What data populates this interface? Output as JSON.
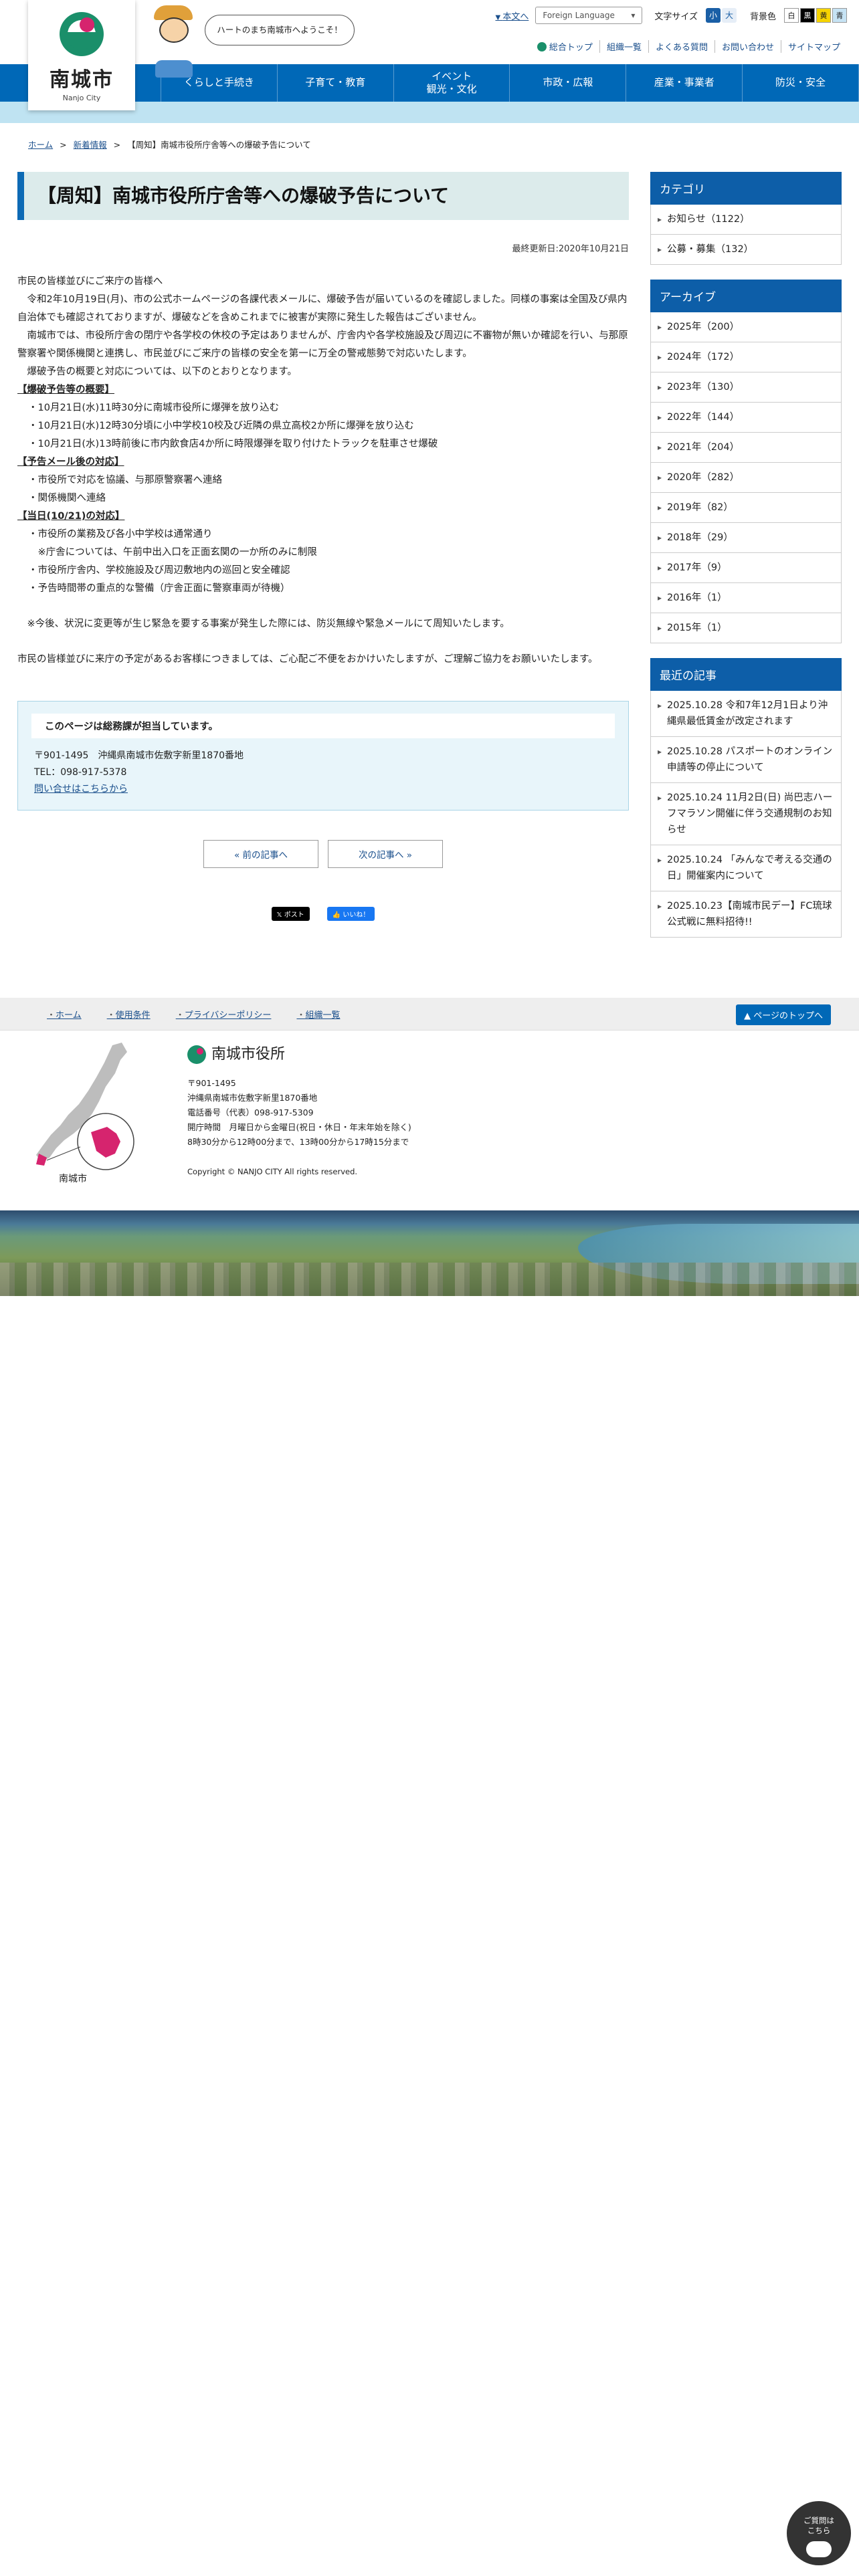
{
  "header": {
    "logo_name": "南城市",
    "logo_sub": "Nanjo City",
    "bubble": "ハートのまち南城市へようこそ！",
    "skip_link": "本文へ",
    "foreign_language": "Foreign Language",
    "font_size_label": "文字サイズ",
    "font_size_small": "小",
    "font_size_large": "大",
    "bg_color_label": "背景色",
    "bg_white": "白",
    "bg_black": "黒",
    "bg_yellow": "黄",
    "bg_blue": "青",
    "util_links": [
      "総合トップ",
      "組織一覧",
      "よくある質問",
      "お問い合わせ",
      "サイトマップ"
    ]
  },
  "nav": {
    "items": [
      "くらしと手続き",
      "子育て・教育",
      "イベント\n観光・文化",
      "市政・広報",
      "産業・事業者",
      "防災・安全"
    ]
  },
  "breadcrumb": {
    "home": "ホーム",
    "news": "新着情報",
    "current": "【周知】南城市役所庁舎等への爆破予告について"
  },
  "article": {
    "title": "【周知】南城市役所庁舎等への爆破予告について",
    "updated": "最終更新日:2020年10月21日",
    "intro": [
      "市民の皆様並びにご来庁の皆様へ",
      "　令和2年10月19日(月)、市の公式ホームページの各課代表メールに、爆破予告が届いているのを確認しました。同様の事案は全国及び県内自治体でも確認されておりますが、爆破などを含めこれまでに被害が実際に発生した報告はございません。",
      "　南城市では、市役所庁舎の閉庁や各学校の休校の予定はありませんが、庁舎内や各学校施設及び周辺に不審物が無いか確認を行い、与那原警察署や関係機関と連携し、市民並びにご来庁の皆様の安全を第一に万全の警戒態勢で対応いたします。",
      "　爆破予告の概要と対応については、以下のとおりとなります。"
    ],
    "sections": [
      {
        "heading": "【爆破予告等の概要】",
        "items": [
          "・10月21日(水)11時30分に南城市役所に爆弾を放り込む",
          "・10月21日(水)12時30分頃に小中学校10校及び近隣の県立高校2か所に爆弾を放り込む",
          "・10月21日(水)13時前後に市内飲食店4か所に時限爆弾を取り付けたトラックを駐車させ爆破"
        ]
      },
      {
        "heading": "【予告メール後の対応】",
        "items": [
          "・市役所で対応を協議、与那原警察署へ連絡",
          "・関係機関へ連絡"
        ]
      },
      {
        "heading": "【当日(10/21)の対応】",
        "items": [
          "・市役所の業務及び各小中学校は通常通り",
          "　※庁舎については、午前中出入口を正面玄関の一か所のみに制限",
          "・市役所庁舎内、学校施設及び周辺敷地内の巡回と安全確認",
          "・予告時間帯の重点的な警備（庁舎正面に警察車両が待機）"
        ]
      }
    ],
    "note": "　※今後、状況に変更等が生じ緊急を要する事案が発生した際には、防災無線や緊急メールにて周知いたします。",
    "closing": "市民の皆様並びに来庁の予定があるお客様につきましては、ご心配ご不便をおかけいたしますが、ご理解ご協力をお願いいたします。"
  },
  "contact": {
    "heading": "このページは総務課が担当しています。",
    "address": "〒901-1495　沖縄県南城市佐敷字新里1870番地",
    "tel": "TEL：098-917-5378",
    "link": "問い合せはこちらから"
  },
  "pager": {
    "prev": "«  前の記事へ",
    "next": "次の記事へ  »"
  },
  "social": {
    "x": "𝕏 ポスト",
    "fb": "👍 いいね！"
  },
  "sidebar": {
    "category_title": "カテゴリ",
    "categories": [
      "お知らせ（1122）",
      "公募・募集（132）"
    ],
    "archive_title": "アーカイブ",
    "archives": [
      "2025年（200）",
      "2024年（172）",
      "2023年（130）",
      "2022年（144）",
      "2021年（204）",
      "2020年（282）",
      "2019年（82）",
      "2018年（29）",
      "2017年（9）",
      "2016年（1）",
      "2015年（1）"
    ],
    "recent_title": "最近の記事",
    "recent": [
      "2025.10.28 令和7年12月1日より沖縄県最低賃金が改定されます",
      "2025.10.28 パスポートのオンライン申請等の停止について",
      "2025.10.24 11月2日(日) 尚巴志ハーフマラソン開催に伴う交通規制のお知らせ",
      "2025.10.24 「みんなで考える交通の日」開催案内について",
      "2025.10.23【南城市民デー】FC琉球公式戦に無料招待!!"
    ]
  },
  "footer_nav": {
    "items": [
      "ホーム",
      "使用条件",
      "プライバシーポリシー",
      "組織一覧"
    ],
    "totop": "▲ ページのトップへ"
  },
  "footer": {
    "map_label": "南城市",
    "org_name": "南城市役所",
    "postal": "〒901-1495",
    "address": "沖縄県南城市佐敷字新里1870番地",
    "tel": "電話番号（代表）098-917-5309",
    "hours1": "開庁時間　月曜日から金曜日(祝日・休日・年末年始を除く)",
    "hours2": "8時30分から12時00分まで、13時00分から17時15分まで",
    "copyright": "Copyright © NANJO CITY All rights reserved."
  },
  "chat": {
    "line1": "ご質問は",
    "line2": "こちら"
  }
}
